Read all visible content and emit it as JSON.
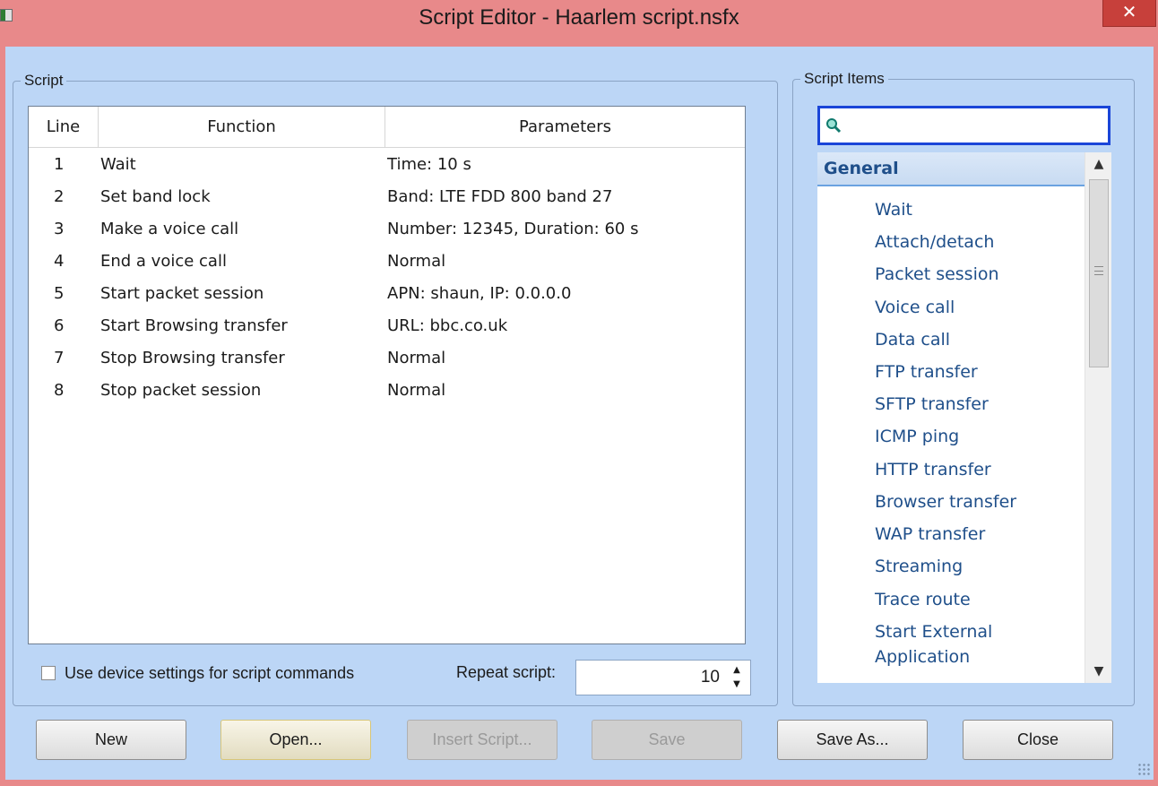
{
  "window": {
    "title": "Script Editor - Haarlem script.nsfx",
    "close_glyph": "✕",
    "colors": {
      "titlebar": "#e8898a",
      "client": "#bcd6f6",
      "close": "#c7403b",
      "accent": "#1a45d8"
    }
  },
  "script": {
    "group_label": "Script",
    "columns": {
      "line": "Line",
      "function": "Function",
      "parameters": "Parameters"
    },
    "rows": [
      {
        "line": "1",
        "function": "Wait",
        "parameters": "Time: 10 s"
      },
      {
        "line": "2",
        "function": "Set band lock",
        "parameters": "Band: LTE FDD 800 band 27"
      },
      {
        "line": "3",
        "function": "Make a voice call",
        "parameters": "Number: 12345, Duration: 60 s"
      },
      {
        "line": "4",
        "function": "End a voice call",
        "parameters": "Normal"
      },
      {
        "line": "5",
        "function": "Start packet session",
        "parameters": "APN: shaun, IP: 0.0.0.0"
      },
      {
        "line": "6",
        "function": "Start Browsing transfer",
        "parameters": "URL: bbc.co.uk"
      },
      {
        "line": "7",
        "function": "Stop Browsing transfer",
        "parameters": "Normal"
      },
      {
        "line": "8",
        "function": "Stop packet session",
        "parameters": "Normal"
      }
    ],
    "use_device_settings_label": "Use device settings for script commands",
    "use_device_settings_checked": false,
    "repeat_label": "Repeat script:",
    "repeat_value": "10"
  },
  "script_items": {
    "group_label": "Script Items",
    "search_value": "",
    "search_icon": "magnifier-icon",
    "category": "General",
    "items": [
      "Wait",
      "Attach/detach",
      "Packet session",
      "Voice call",
      "Data call",
      "FTP transfer",
      "SFTP transfer",
      "ICMP ping",
      "HTTP transfer",
      "Browser transfer",
      "WAP transfer",
      "Streaming",
      "Trace route",
      "Start External Application"
    ]
  },
  "buttons": {
    "new": "New",
    "open": "Open...",
    "insert_script": "Insert Script...",
    "save": "Save",
    "save_as": "Save As...",
    "close": "Close"
  }
}
